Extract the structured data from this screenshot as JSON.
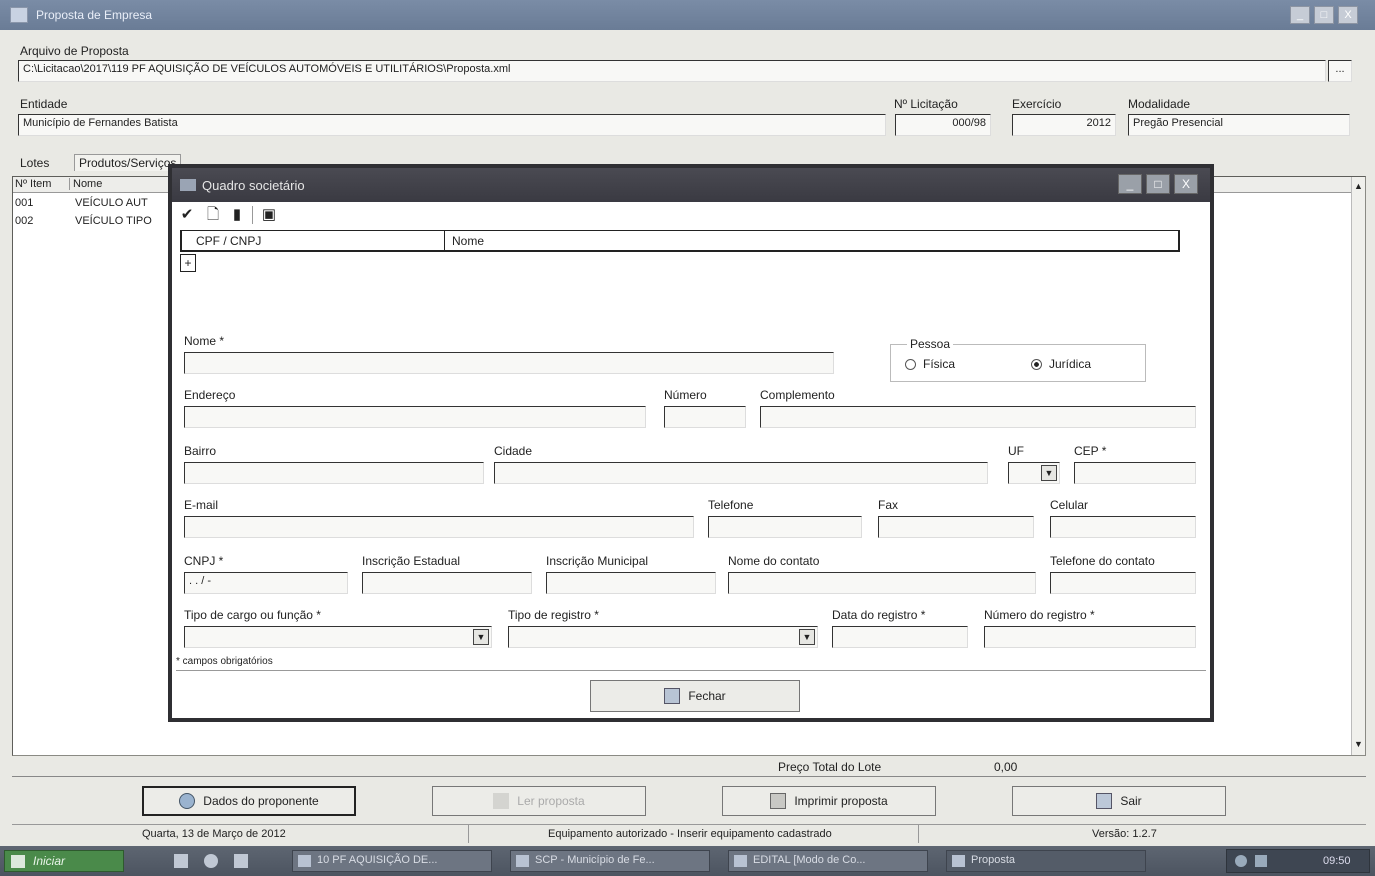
{
  "window": {
    "title": "Proposta de Empresa",
    "min": "_",
    "max": "□",
    "close": "X"
  },
  "proposal_file": {
    "label": "Arquivo de Proposta",
    "value": "C:\\Licitacao\\2017\\119 PF AQUISIÇÃO DE VEÍCULOS AUTOMÓVEIS E UTILITÁRIOS\\Proposta.xml",
    "browse": "..."
  },
  "entity": {
    "label": "Entidade",
    "value": "Município de Fernandes Batista",
    "licitacao_label": "Nº Licitação",
    "licitacao_value": "000/98",
    "exercicio_label": "Exercício",
    "exercicio_value": "2012",
    "modalidade_label": "Modalidade",
    "modalidade_value": "Pregão Presencial"
  },
  "tabs": {
    "lotes": "Lotes",
    "produtos": "Produtos/Serviços"
  },
  "item_list": {
    "col_num": "Nº Item",
    "col_name": "Nome",
    "rows": [
      {
        "num": "001",
        "name": "VEÍCULO AUT"
      },
      {
        "num": "002",
        "name": "VEÍCULO TIPO"
      }
    ]
  },
  "dialog": {
    "title": "Quadro societário",
    "min": "_",
    "max": "□",
    "close": "X",
    "grid": {
      "col1": "CPF / CNPJ",
      "col2": "Nome",
      "add": "+"
    },
    "labels": {
      "nome": "Nome *",
      "pessoa": "Pessoa",
      "fisica": "Física",
      "juridica": "Jurídica",
      "endereco": "Endereço",
      "numero": "Número",
      "complemento": "Complemento",
      "bairro": "Bairro",
      "cidade": "Cidade",
      "uf": "UF",
      "cep": "CEP *",
      "email": "E-mail",
      "telefone": "Telefone",
      "fax": "Fax",
      "celular": "Celular",
      "cnpj": "CNPJ *",
      "inscricao_estadual": "Inscrição Estadual",
      "inscricao_municipal": "Inscrição Municipal",
      "nome_contato": "Nome do contato",
      "telefone_contato": "Telefone do contato",
      "tipo_cargo": "Tipo de cargo ou função *",
      "tipo_registro": "Tipo de registro *",
      "data_registro": "Data do registro *",
      "numero_registro": "Número do registro *",
      "required_note": "* campos obrigatórios"
    },
    "values": {
      "cnpj_mask": ". . / -"
    },
    "fechar": "Fechar"
  },
  "totals": {
    "label": "Preço Total do Lote",
    "value": "0,00"
  },
  "buttons": {
    "dados": "Dados do proponente",
    "carregar": "Ler proposta",
    "imprimir": "Imprimir proposta",
    "sair": "Sair"
  },
  "status": {
    "date": "Quarta, 13 de Março de 2012",
    "message": "Equipamento autorizado - Inserir equipamento cadastrado",
    "version": "Versão: 1.2.7"
  },
  "taskbar": {
    "start": "Iniciar",
    "tasks": [
      "10 PF AQUISIÇÃO DE...",
      "SCP - Município de Fe...",
      "EDITAL [Modo de Co...",
      "Proposta"
    ],
    "clock": "09:50"
  }
}
